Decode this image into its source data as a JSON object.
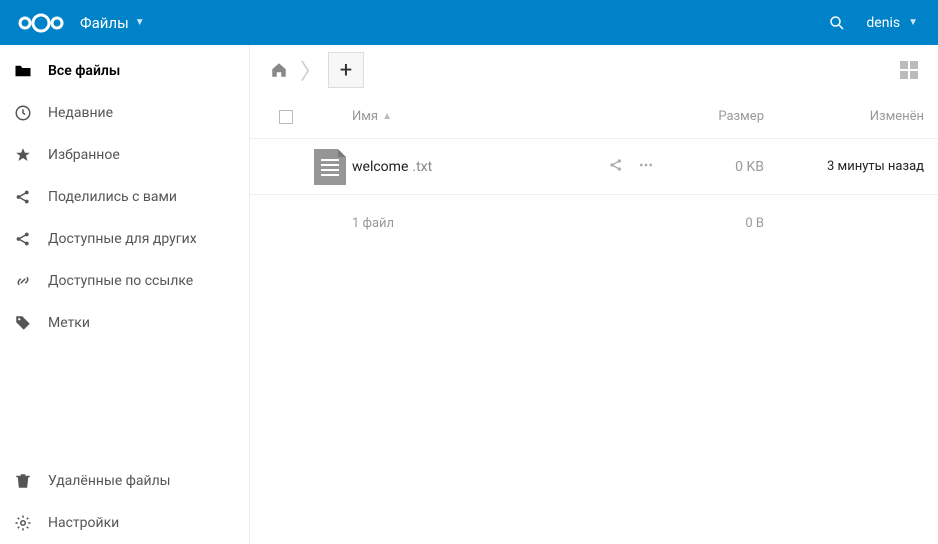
{
  "header": {
    "app_label": "Файлы",
    "username": "denis"
  },
  "sidebar": {
    "items": [
      {
        "label": "Все файлы"
      },
      {
        "label": "Недавние"
      },
      {
        "label": "Избранное"
      },
      {
        "label": "Поделились с вами"
      },
      {
        "label": "Доступные для других"
      },
      {
        "label": "Доступные по ссылке"
      },
      {
        "label": "Метки"
      }
    ],
    "bottom": {
      "trash": "Удалённые файлы",
      "settings": "Настройки"
    }
  },
  "table": {
    "headers": {
      "name": "Имя",
      "size": "Размер",
      "modified": "Изменён"
    },
    "rows": [
      {
        "name": "welcome",
        "ext": ".txt",
        "size": "0 KB",
        "modified": "3 минуты назад"
      }
    ],
    "summary": {
      "count": "1 файл",
      "size": "0 B"
    }
  }
}
